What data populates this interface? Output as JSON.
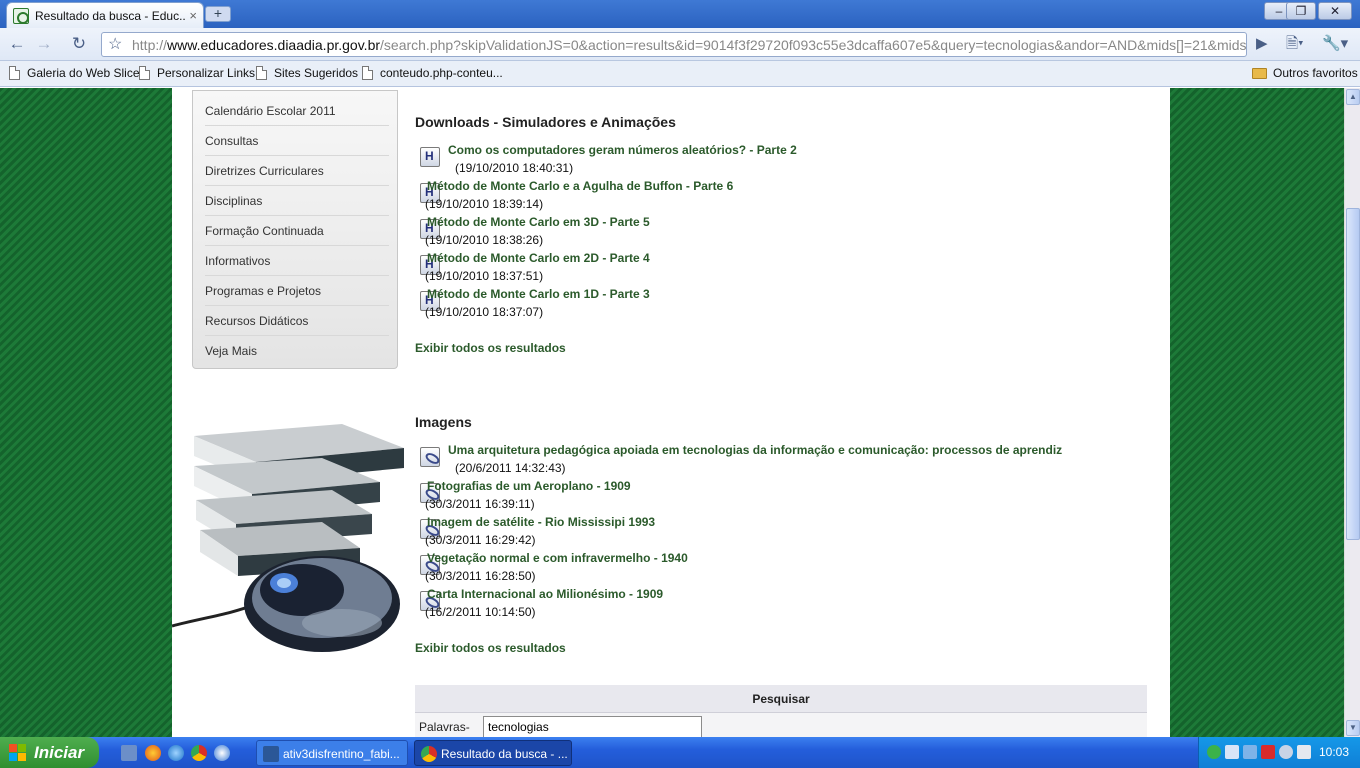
{
  "browser": {
    "tab_title": "Resultado da busca - Educ...",
    "tab_close": "×",
    "new_tab": "+",
    "url_scheme": "http://",
    "url_host": "www.educadores.diaadia.pr.gov.br",
    "url_rest": "/search.php?skipValidationJS=0&action=results&id=9014f3f29720f093c55e3dcaffa607e5&query=tecnologias&andor=AND&mids[]=21&mids",
    "window_controls": [
      "–",
      "❐",
      "✕"
    ]
  },
  "bookmarks": {
    "items": [
      "Galeria do Web Slice",
      "Personalizar Links",
      "Sites Sugeridos",
      "conteudo.php-conteu..."
    ],
    "other": "Outros favoritos"
  },
  "menu": {
    "items": [
      "Calendário Escolar 2011",
      "Consultas",
      "Diretrizes Curriculares",
      "Disciplinas",
      "Formação Continuada",
      "Informativos",
      "Programas e Projetos",
      "Recursos Didáticos",
      "Veja Mais"
    ]
  },
  "downloads": {
    "heading": "Downloads - Simuladores e Animações",
    "items": [
      {
        "title": "Como os computadores geram números aleatórios? - Parte 2",
        "date": "(19/10/2010 18:40:31)"
      },
      {
        "title": "Método de Monte Carlo e a Agulha de Buffon - Parte 6",
        "date": "(19/10/2010 18:39:14)"
      },
      {
        "title": "Método de Monte Carlo em 3D - Parte 5",
        "date": "(19/10/2010 18:38:26)"
      },
      {
        "title": "Método de Monte Carlo em 2D - Parte 4",
        "date": "(19/10/2010 18:37:51)"
      },
      {
        "title": "Método de Monte Carlo em 1D - Parte 3",
        "date": "(19/10/2010 18:37:07)"
      }
    ],
    "show_all": "Exibir todos os resultados"
  },
  "images": {
    "heading": "Imagens",
    "items": [
      {
        "title": "Uma arquitetura pedagógica apoiada em tecnologias da informação e comunicação: processos de aprendiz",
        "date": "(20/6/2011 14:32:43)"
      },
      {
        "title": "Fotografias de um Aeroplano - 1909",
        "date": "(30/3/2011 16:39:11)"
      },
      {
        "title": "Imagem de satélite - Rio Mississipi 1993",
        "date": "(30/3/2011 16:29:42)"
      },
      {
        "title": "Vegetação normal e com infravermelho - 1940",
        "date": "(30/3/2011 16:28:50)"
      },
      {
        "title": "Carta Internacional ao Milionésimo - 1909",
        "date": "(16/2/2011 10:14:50)"
      }
    ],
    "show_all": "Exibir todos os resultados"
  },
  "search": {
    "heading": "Pesquisar",
    "label": "Palavras-",
    "value": "tecnologias"
  },
  "taskbar": {
    "start": "Iniciar",
    "tasks": [
      "ativ3disfrentino_fabi...",
      "Resultado da busca - ..."
    ],
    "clock": "10:03"
  }
}
